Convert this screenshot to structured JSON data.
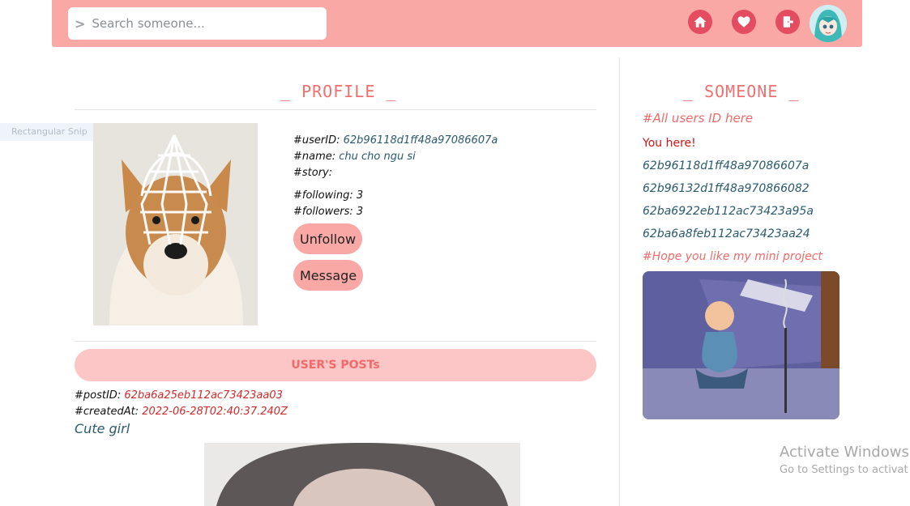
{
  "navbar": {
    "search_placeholder": "Search someone...",
    "chevron": ">",
    "icons": [
      "home-icon",
      "heart-icon",
      "logout-icon"
    ]
  },
  "snip_label": "Rectangular Snip",
  "profile": {
    "title": "_ PROFILE _",
    "userid_label": "#userID:",
    "userid_value": "62b96118d1ff48a97086607a",
    "name_label": "#name:",
    "name_value": "chu cho ngu si",
    "story_label": "#story:",
    "following_label": "#following:",
    "following_value": "3",
    "followers_label": "#followers:",
    "followers_value": "3",
    "unfollow_label": "Unfollow",
    "message_label": "Message"
  },
  "posts": {
    "title": "USER'S POSTs",
    "postid_label": "#postID:",
    "postid_value": "62ba6a25eb112ac73423aa03",
    "created_label": "#createdAt:",
    "created_value": "2022-06-28T02:40:37.240Z",
    "caption": "Cute girl"
  },
  "sidebar": {
    "title": "_ SOMEONE _",
    "all_users_heading": "#All users ID here",
    "you_here": "You here!",
    "user_ids": [
      "62b96118d1ff48a97086607a",
      "62b96132d1ff48a970866082",
      "62ba6922eb112ac73423a95a",
      "62ba6a8feb112ac73423aa24"
    ],
    "hope_text": "#Hope you like my mini project"
  },
  "watermark": {
    "line1": "Activate Windows",
    "line2": "Go to Settings to activat"
  },
  "colors": {
    "navbar": "#f9a8a6",
    "accent": "#f06f6f",
    "icon_bg": "#e44c61",
    "link": "#2a5a6e",
    "posts_bar": "#fdc6c6"
  }
}
